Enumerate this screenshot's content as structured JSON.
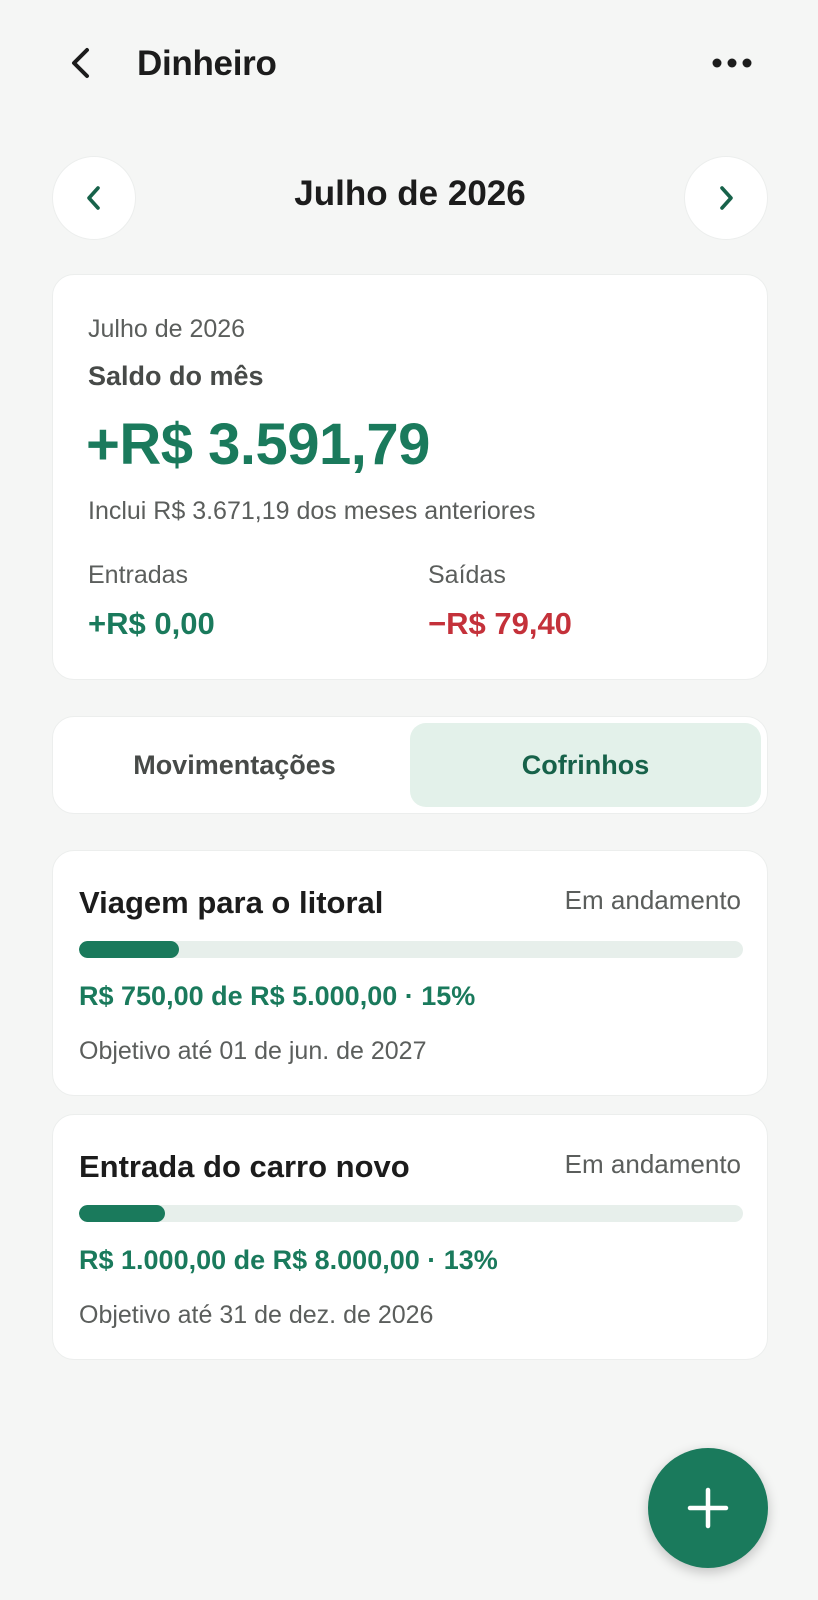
{
  "header": {
    "title": "Dinheiro",
    "back_icon": "chevron-left-icon",
    "more_icon": "more-horizontal-icon"
  },
  "month_nav": {
    "label": "Julho de 2026",
    "prev_icon": "chevron-left-icon",
    "next_icon": "chevron-right-icon"
  },
  "balance": {
    "period": "Julho de 2026",
    "label": "Saldo do mês",
    "amount": "+R$ 3.591,79",
    "note": "Inclui R$ 3.671,19 dos meses anteriores",
    "income_label": "Entradas",
    "income_value": "+R$ 0,00",
    "expense_label": "Saídas",
    "expense_value": "−R$ 79,40"
  },
  "tabs": [
    {
      "label": "Movimentações",
      "active": false
    },
    {
      "label": "Cofrinhos",
      "active": true
    }
  ],
  "goals": [
    {
      "title": "Viagem para o litoral",
      "status": "Em andamento",
      "progress_percent": 15,
      "amount_text": "R$ 750,00 de R$ 5.000,00 · 15%",
      "deadline": "Objetivo até 01 de jun. de 2027"
    },
    {
      "title": "Entrada do carro novo",
      "status": "Em andamento",
      "progress_percent": 13,
      "amount_text": "R$ 1.000,00 de R$ 8.000,00 · 13%",
      "deadline": "Objetivo até 31 de dez. de 2026"
    }
  ],
  "fab": {
    "icon": "plus-icon"
  },
  "colors": {
    "accent": "#1a7a5c",
    "negative": "#c4313a",
    "tab_active_bg": "#e3f1ea",
    "background": "#f5f6f5"
  }
}
